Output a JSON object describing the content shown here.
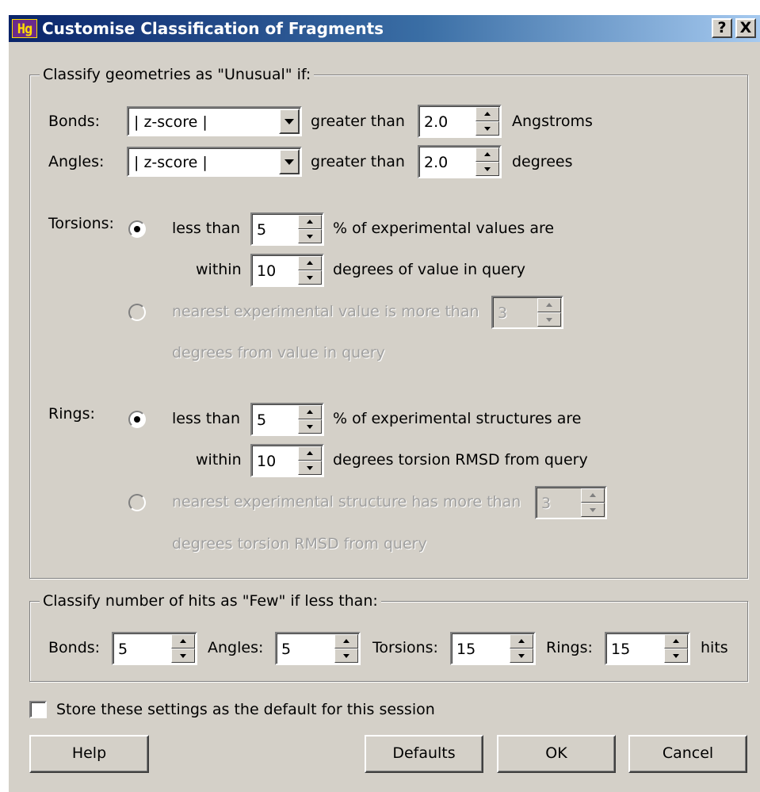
{
  "window": {
    "title": "Customise Classification of Fragments",
    "app_icon_text": "Hg",
    "help_caption": "?",
    "close_caption": "X"
  },
  "unusual_group": {
    "label": "Classify geometries as \"Unusual\" if:",
    "bonds": {
      "label": "Bonds:",
      "combo_value": "| z-score |",
      "comparator": "greater than",
      "value": "2.0",
      "unit": "Angstroms"
    },
    "angles": {
      "label": "Angles:",
      "combo_value": "| z-score |",
      "comparator": "greater than",
      "value": "2.0",
      "unit": "degrees"
    },
    "torsions": {
      "label": "Torsions:",
      "option1_selected": true,
      "less_than_label": "less than",
      "percent_value": "5",
      "percent_text": "% of experimental values are",
      "within_label": "within",
      "within_value": "10",
      "within_text": "degrees of value in query",
      "option2_text": "nearest experimental value is more than",
      "option2_value": "3",
      "option2_text2": "degrees from value in query"
    },
    "rings": {
      "label": "Rings:",
      "option1_selected": true,
      "less_than_label": "less than",
      "percent_value": "5",
      "percent_text": "% of experimental structures are",
      "within_label": "within",
      "within_value": "10",
      "within_text": "degrees torsion RMSD from query",
      "option2_text": "nearest experimental structure has more than",
      "option2_value": "3",
      "option2_text2": "degrees torsion RMSD from query"
    }
  },
  "few_group": {
    "label": "Classify number of hits as \"Few\" if less than:",
    "bonds_label": "Bonds:",
    "bonds_value": "5",
    "angles_label": "Angles:",
    "angles_value": "5",
    "torsions_label": "Torsions:",
    "torsions_value": "15",
    "rings_label": "Rings:",
    "rings_value": "15",
    "hits_label": "hits"
  },
  "store_default": {
    "label": "Store these settings as the default for this session",
    "checked": false
  },
  "buttons": {
    "help": "Help",
    "defaults": "Defaults",
    "ok": "OK",
    "cancel": "Cancel"
  }
}
